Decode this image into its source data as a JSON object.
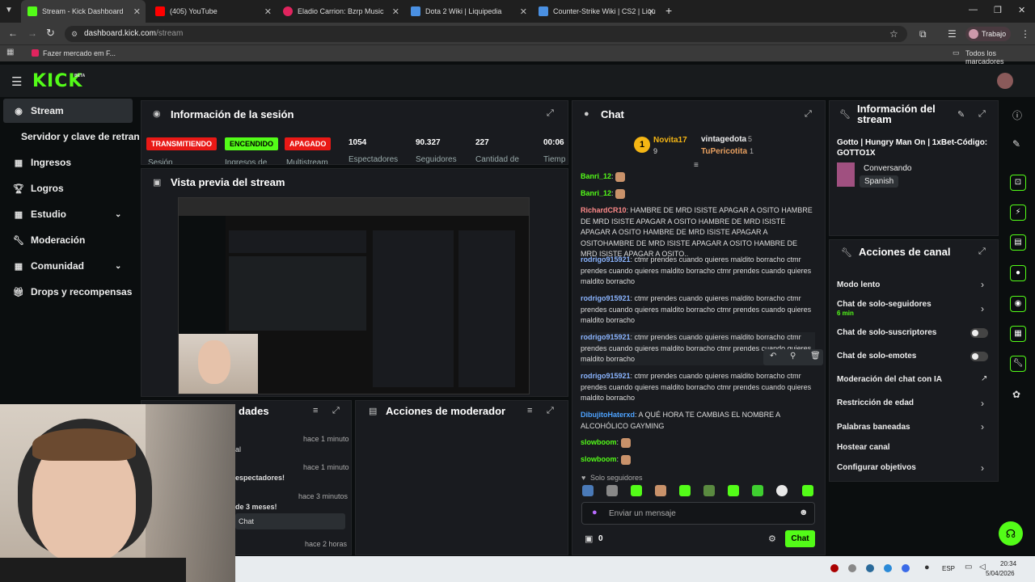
{
  "browser": {
    "tabs": [
      {
        "title": "Stream - Kick Dashboard",
        "color": "#53fc18"
      },
      {
        "title": "(405) YouTube",
        "color": "#ff0000"
      },
      {
        "title": "Eladio Carrion: Bzrp Music",
        "color": "#e0245e"
      },
      {
        "title": "Dota 2 Wiki | Liquipedia",
        "color": "#4a90e2"
      },
      {
        "title": "Counter-Strike Wiki | CS2 | Liqu",
        "color": "#4a90e2"
      }
    ],
    "url_domain": "dashboard.kick.com",
    "url_path": "/stream",
    "profile": "Trabajo",
    "bookmark": "Fazer mercado em F...",
    "all_bookmarks": "Todos los marcadores"
  },
  "kick": {
    "logo": "KICK",
    "beta": "BETA"
  },
  "sidebar": {
    "items": [
      {
        "label": "Stream",
        "icon": "broadcast-icon"
      },
      {
        "label": "Servidor y clave de retransm",
        "icon": ""
      },
      {
        "label": "Ingresos",
        "icon": "grid-icon"
      },
      {
        "label": "Logros",
        "icon": "trophy-icon"
      },
      {
        "label": "Estudio",
        "icon": "grid-icon"
      },
      {
        "label": "Moderación",
        "icon": "wrench-icon"
      },
      {
        "label": "Comunidad",
        "icon": "grid-icon"
      },
      {
        "label": "Drops y recompensas",
        "icon": "gift-icon"
      }
    ]
  },
  "session": {
    "title": "Información de la sesión",
    "badges": [
      {
        "label": "TRANSMITIENDO",
        "caption": "Sesión"
      },
      {
        "label": "ENCENDIDO",
        "caption": "Ingresos de"
      },
      {
        "label": "APAGADO",
        "caption": "Multistream"
      }
    ],
    "stats": [
      {
        "value": "1054",
        "label": "Espectadores"
      },
      {
        "value": "90.327",
        "label": "Seguidores"
      },
      {
        "value": "227",
        "label": "Cantidad de"
      },
      {
        "value": "00:06",
        "label": "Tiemp"
      }
    ]
  },
  "preview": {
    "title": "Vista previa del stream"
  },
  "activity": {
    "title": "dades",
    "items": [
      {
        "text": "al",
        "time": "hace 1 minuto"
      },
      {
        "text": "espectadores!",
        "time": "hace 1 minuto"
      },
      {
        "text": "de 3 meses!",
        "time": "hace 3 minutos"
      },
      {
        "text": "",
        "time": "hace 2 horas"
      }
    ]
  },
  "modactions": {
    "title": "Acciones de moderador"
  },
  "chat": {
    "title": "Chat",
    "top": [
      {
        "name": "Novita17",
        "count": "9"
      },
      {
        "name": "vintagedota",
        "count": "5"
      },
      {
        "name": "TuPericotita",
        "count": "1"
      }
    ],
    "messages": [
      {
        "user": "Banri_12",
        "text": "",
        "color": "#53fc18"
      },
      {
        "user": "Banri_12",
        "text": "",
        "color": "#53fc18"
      },
      {
        "user": "RichardCR10",
        "text": "HAMBRE DE MRD ISISTE APAGAR A OSITO HAMBRE DE MRD ISISTE APAGAR A OSITO HAMBRE DE MRD ISISTE APAGAR A OSITO HAMBRE DE MRD ISISTE APAGAR A OSITOHAMBRE DE MRD ISISTE APAGAR A OSITO HAMBRE DE MRD ISISTE APAGAR A OSITO..",
        "color": "#ff8a8a"
      },
      {
        "user": "rodrigo915921",
        "text": "ctmr prendes cuando quieres maldito borracho ctmr prendes cuando quieres maldito borracho ctmr prendes cuando quieres maldito borracho",
        "color": "#8ab4ff"
      },
      {
        "user": "rodrigo915921",
        "text": "ctmr prendes cuando quieres maldito borracho ctmr prendes cuando quieres maldito borracho ctmr prendes cuando quieres maldito borracho",
        "color": "#8ab4ff"
      },
      {
        "user": "rodrigo915921",
        "text": "ctmr prendes cuando quieres maldito borracho ctmr prendes cuando quieres maldito borracho ctmr prendes cuando quieres maldito borracho",
        "color": "#8ab4ff"
      },
      {
        "user": "rodrigo915921",
        "text": "ctmr prendes cuando quieres maldito borracho ctmr prendes cuando quieres maldito borracho ctmr prendes cuando quieres maldito borracho",
        "color": "#8ab4ff"
      },
      {
        "user": "DibujitoHaterxd",
        "text": "A QUÉ HORA TE CAMBIAS EL NOMBRE A ALCOHÓLICO GAYMING",
        "color": "#4ea3ff"
      },
      {
        "user": "slowboom",
        "text": "",
        "color": "#53fc18"
      },
      {
        "user": "slowboom",
        "text": "",
        "color": "#53fc18"
      }
    ],
    "followers_only": "Solo seguidores",
    "input_placeholder": "Enviar un mensaje",
    "points": "0",
    "send": "Chat"
  },
  "stream_info": {
    "title": "Información del stream",
    "stream_title": "Gotto | Hungry Man On | 1xBet-Código: GOTTO1X",
    "category": "Conversando",
    "language": "Spanish"
  },
  "channel_actions": {
    "title": "Acciones de canal",
    "items": [
      {
        "label": "Modo lento",
        "sub": "",
        "type": "chevron"
      },
      {
        "label": "Chat de solo-seguidores",
        "sub": "6 min",
        "type": "chevron"
      },
      {
        "label": "Chat de solo-suscriptores",
        "sub": "",
        "type": "toggle"
      },
      {
        "label": "Chat de solo-emotes",
        "sub": "",
        "type": "toggle"
      },
      {
        "label": "Moderación del chat con IA",
        "sub": "",
        "type": "external"
      },
      {
        "label": "Restricción de edad",
        "sub": "",
        "type": "chevron"
      },
      {
        "label": "Palabras baneadas",
        "sub": "",
        "type": "chevron"
      },
      {
        "label": "Hostear canal",
        "sub": "",
        "type": "none"
      },
      {
        "label": "Configurar objetivos",
        "sub": "",
        "type": "chevron"
      }
    ]
  },
  "taskbar": {
    "lang": "ESP",
    "time": "20:34",
    "date": "5/04/2026"
  },
  "colors": {
    "accent": "#53fc18",
    "live": "#e91916",
    "panel": "#191b1f"
  }
}
